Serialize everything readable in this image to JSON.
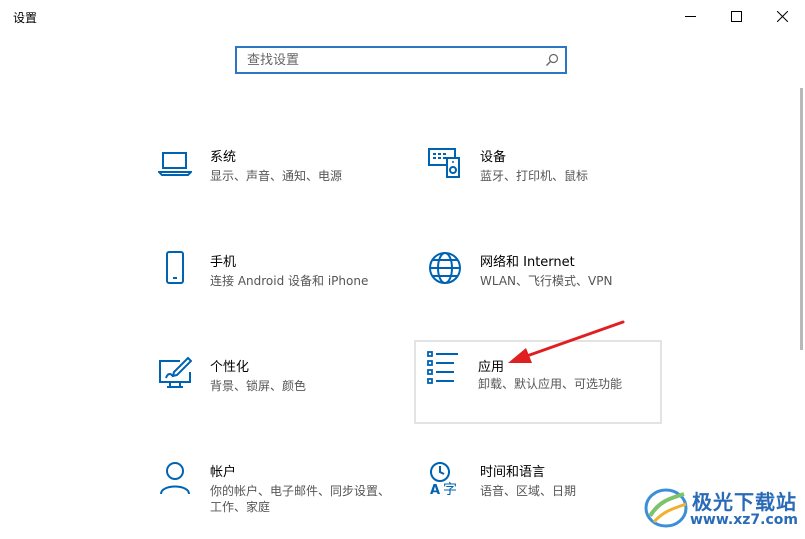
{
  "window": {
    "title": "设置",
    "minimize_icon": "minimize-icon",
    "maximize_icon": "maximize-icon",
    "close_icon": "close-icon"
  },
  "search": {
    "placeholder": "查找设置",
    "value": "",
    "icon": "search-icon"
  },
  "categories": [
    {
      "title": "系统",
      "subtitle": "显示、声音、通知、电源",
      "icon": "laptop-icon"
    },
    {
      "title": "设备",
      "subtitle": "蓝牙、打印机、鼠标",
      "icon": "devices-icon"
    },
    {
      "title": "手机",
      "subtitle": "连接 Android 设备和 iPhone",
      "icon": "phone-icon"
    },
    {
      "title": "网络和 Internet",
      "subtitle": "WLAN、飞行模式、VPN",
      "icon": "globe-icon"
    },
    {
      "title": "个性化",
      "subtitle": "背景、锁屏、颜色",
      "icon": "personalization-icon"
    },
    {
      "title": "应用",
      "subtitle": "卸载、默认应用、可选功能",
      "icon": "apps-list-icon"
    },
    {
      "title": "帐户",
      "subtitle": "你的帐户、电子邮件、同步设置、工作、家庭",
      "icon": "person-icon"
    },
    {
      "title": "时间和语言",
      "subtitle": "语音、区域、日期",
      "icon": "time-language-icon"
    }
  ],
  "annotation": {
    "icon": "red-arrow-icon",
    "color": "#e02020"
  },
  "watermark": {
    "text": "极光下载站",
    "url": "www.xz7.com",
    "logo": "aurora-logo-icon"
  },
  "colors": {
    "accent": "#0063b1",
    "search_border": "#2b78c2",
    "subtitle": "#555555"
  }
}
